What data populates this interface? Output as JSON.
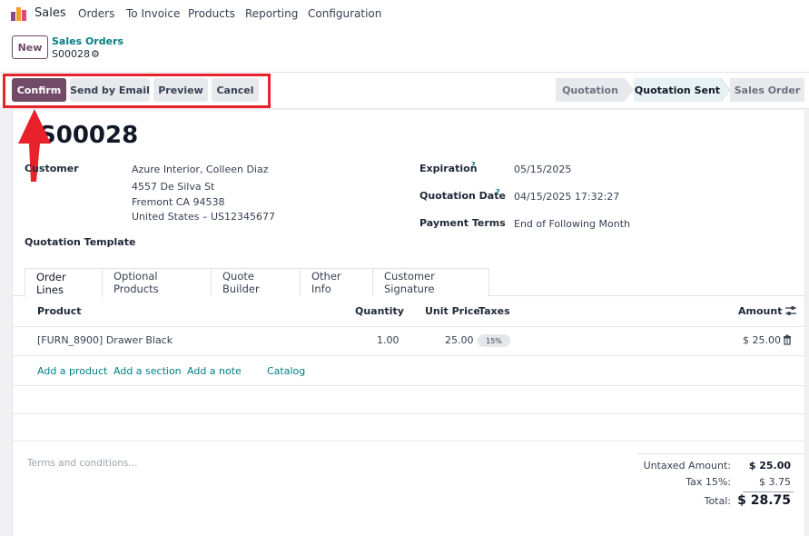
{
  "app": {
    "name": "Sales",
    "logo_icon": "odoo-sales-logo-icon"
  },
  "nav": {
    "items": [
      "Orders",
      "To Invoice",
      "Products",
      "Reporting",
      "Configuration"
    ]
  },
  "control": {
    "new_label": "New",
    "breadcrumb_parent": "Sales Orders",
    "breadcrumb_current": "S00028",
    "gear_icon": "gear-icon"
  },
  "actions": {
    "confirm": "Confirm",
    "send_email": "Send by Email",
    "preview": "Preview",
    "cancel": "Cancel"
  },
  "statusbar": {
    "steps": [
      "Quotation",
      "Quotation Sent",
      "Sales Order"
    ],
    "active_index": 1
  },
  "record": {
    "title": "S00028",
    "customer_label": "Customer",
    "customer_lines": [
      "Azure Interior, Colleen Diaz",
      "4557 De Silva St",
      "Fremont CA 94538",
      "United States – US12345677"
    ],
    "quotation_template_label": "Quotation Template",
    "expiration_label": "Expiration",
    "expiration_value": "05/15/2025",
    "quotation_date_label": "Quotation Date",
    "quotation_date_value": "04/15/2025 17:32:27",
    "payment_terms_label": "Payment Terms",
    "payment_terms_value": "End of Following Month",
    "help_mark": "?"
  },
  "tabs": [
    "Order Lines",
    "Optional Products",
    "Quote Builder",
    "Other Info",
    "Customer Signature"
  ],
  "table": {
    "headers": {
      "product": "Product",
      "quantity": "Quantity",
      "unit_price": "Unit Price",
      "taxes": "Taxes",
      "amount": "Amount"
    },
    "rows": [
      {
        "product": "[FURN_8900] Drawer Black",
        "quantity": "1.00",
        "unit_price": "25.00",
        "tax": "15%",
        "amount": "$ 25.00"
      }
    ],
    "add_links": [
      "Add a product",
      "Add a section",
      "Add a note",
      "Catalog"
    ]
  },
  "footer": {
    "terms_placeholder": "Terms and conditions...",
    "untaxed_label": "Untaxed Amount:",
    "untaxed_value": "$ 25.00",
    "tax_label": "Tax 15%:",
    "tax_value": "$ 3.75",
    "total_label": "Total:",
    "total_value": "$ 28.75"
  },
  "colors": {
    "brand": "#714b67",
    "link": "#017e84",
    "highlight": "#e8212b"
  }
}
